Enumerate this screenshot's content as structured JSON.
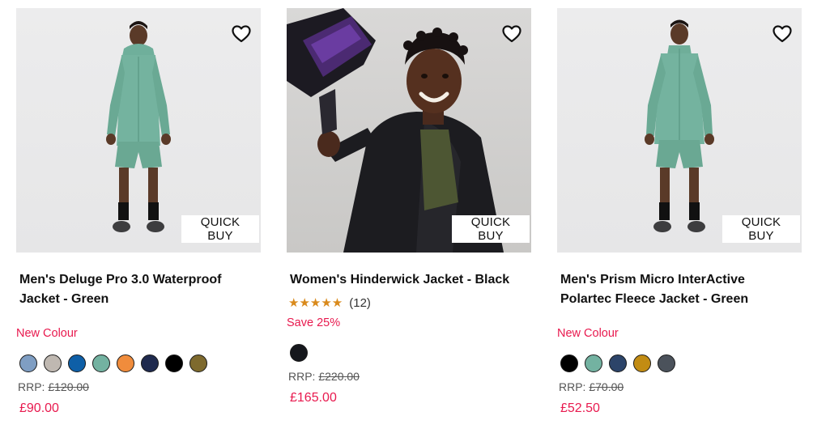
{
  "products": [
    {
      "title": "Men's Deluge Pro 3.0 Waterproof Jacket - Green",
      "quick_buy": "QUICK BUY",
      "badge": "New Colour",
      "swatches": [
        "#7f9ec3",
        "#bfb8b1",
        "#0e5fa7",
        "#73b2a1",
        "#f08c3c",
        "#1f2a4e",
        "#000000",
        "#7e6a2e"
      ],
      "rrp_label": "RRP:",
      "rrp_value": "£120.00",
      "price": "£90.00",
      "image": "man-green-jacket-shorts"
    },
    {
      "title": "Women's Hinderwick Jacket - Black",
      "quick_buy": "QUICK BUY",
      "stars": "★★★★★",
      "rating_count": "(12)",
      "badge": "Save 25%",
      "swatches": [
        "#15171c"
      ],
      "rrp_label": "RRP:",
      "rrp_value": "£220.00",
      "price": "£165.00",
      "image": "woman-black-jacket-bottle"
    },
    {
      "title": "Men's Prism Micro InterActive Polartec Fleece Jacket - Green",
      "quick_buy": "QUICK BUY",
      "badge": "New Colour",
      "swatches": [
        "#000000",
        "#73b2a1",
        "#2c4469",
        "#c28c13",
        "#4b525b"
      ],
      "rrp_label": "RRP:",
      "rrp_value": "£70.00",
      "price": "£52.50",
      "image": "man-green-fleece-shorts"
    }
  ],
  "colors": {
    "accent_pink": "#e8194e",
    "star": "#d98a1c"
  },
  "icons": {
    "wishlist": "heart-outline-icon"
  }
}
